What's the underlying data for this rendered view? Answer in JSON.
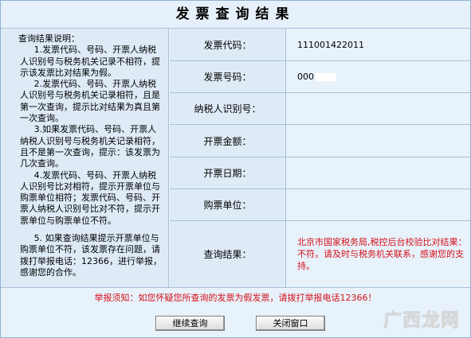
{
  "title": "发票查询结果",
  "notes": {
    "heading": "查询结果说明：",
    "items": [
      "1.发票代码、号码、开票人纳税人识别号与税务机关记录不相符，提示该发票比对结果为假。",
      "2.发票代码、号码、开票人纳税人识别号与税务机关记录相符，且是第一次查询，提示比对结果为真且第一次查询。",
      "3.如果发票代码、号码、开票人纳税人识别号与税务机关记录相符，且不是第一次查询，提示：该发票为几次查询。",
      "4.发票代码、号码、开票人纳税人识别号比对相符，提示开票单位与购票单位相符；发票代码、号码、开票人纳税人识别号比对不符，提示开票单位与购票单位不符。",
      "5. 如果查询结果提示开票单位与购票单位不符，该发票存在问题，请拨打举报电话：12366，进行举报，感谢您的合作。"
    ]
  },
  "fields": {
    "invoice_code": {
      "label": "发票代码：",
      "value": "111001422011"
    },
    "invoice_number": {
      "label": "发票号码：",
      "value": "000"
    },
    "taxpayer_id": {
      "label": "纳税人识别号：",
      "value": ""
    },
    "amount": {
      "label": "开票金额：",
      "value": ""
    },
    "date": {
      "label": "开票日期：",
      "value": ""
    },
    "buyer": {
      "label": "购票单位：",
      "value": ""
    },
    "result": {
      "label": "查询结果：",
      "value": "北京市国家税务局,税控后台校验比对结果：不符。请及时与税务机关联系，感谢您的支持。"
    }
  },
  "warning": "举报须知：如您怀疑您所查询的发票为假发票，请拨打举报电话12366！",
  "buttons": {
    "continue": "继续查询",
    "close": "关闭窗口"
  },
  "watermark": "广西龙网",
  "colors": {
    "red_text": "#d4101a",
    "panel_bg": "#e8f2fb",
    "border": "#a7c1da"
  }
}
